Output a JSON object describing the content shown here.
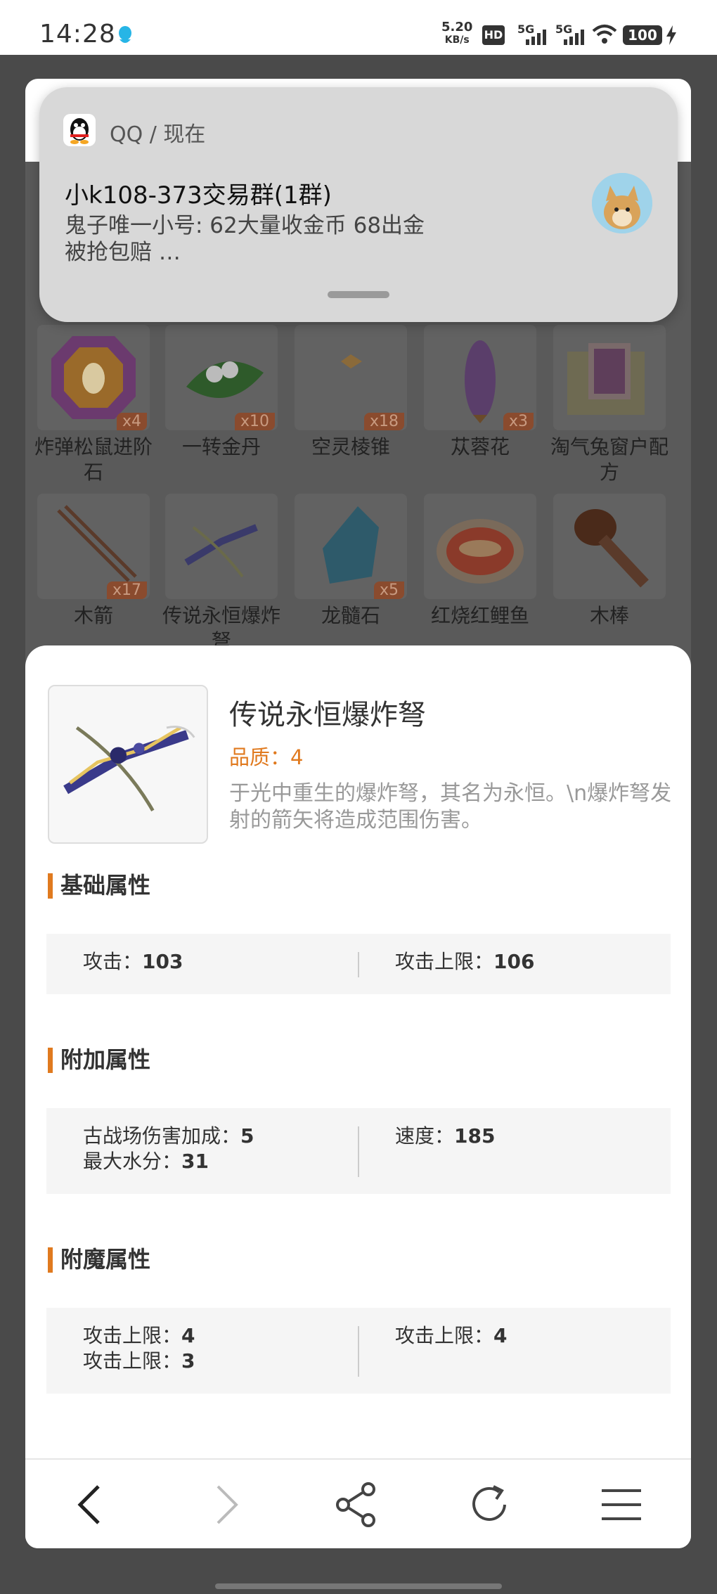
{
  "status_bar": {
    "time": "14:28",
    "speed_value": "5.20",
    "speed_unit": "KB/s",
    "hd_label": "HD",
    "network_1": "5G",
    "network_2": "5G",
    "battery": "100"
  },
  "notification": {
    "app_line": "QQ / 现在",
    "title": "小k108-373交易群(1群)",
    "body": "鬼子唯一小号: 62大量收金币  68出金\n 被抢包赔 …"
  },
  "grid_items": [
    {
      "name": "炸弹松鼠进阶石",
      "count": "x4",
      "icon": "gem-icon"
    },
    {
      "name": "一转金丹",
      "count": "x10",
      "icon": "pill-icon"
    },
    {
      "name": "空灵棱锥",
      "count": "x18",
      "icon": "pyramid-icon"
    },
    {
      "name": "苁蓉花",
      "count": "x3",
      "icon": "flower-icon"
    },
    {
      "name": "淘气兔窗户配方",
      "count": "",
      "icon": "scroll-icon"
    },
    {
      "name": "木箭",
      "count": "x17",
      "icon": "arrow-icon"
    },
    {
      "name": "传说永恒爆炸弩",
      "count": "",
      "icon": "crossbow-icon"
    },
    {
      "name": "龙髓石",
      "count": "x5",
      "icon": "crystal-icon"
    },
    {
      "name": "红烧红鲤鱼",
      "count": "",
      "icon": "fish-dish-icon"
    },
    {
      "name": "木棒",
      "count": "",
      "icon": "club-icon"
    }
  ],
  "detail": {
    "name": "传说永恒爆炸弩",
    "quality": "品质：4",
    "description": "于光中重生的爆炸弩，其名为永恒。\\n爆炸弩发射的箭矢将造成范围伤害。",
    "sections": [
      {
        "title": "基础属性",
        "left": [
          {
            "label": "攻击：",
            "value": "103"
          }
        ],
        "right": [
          {
            "label": "攻击上限：",
            "value": "106"
          }
        ]
      },
      {
        "title": "附加属性",
        "left": [
          {
            "label": "古战场伤害加成：",
            "value": "5"
          },
          {
            "label": "最大水分：",
            "value": "31"
          }
        ],
        "right": [
          {
            "label": "速度：",
            "value": "185"
          }
        ]
      },
      {
        "title": "附魔属性",
        "left": [
          {
            "label": "攻击上限：",
            "value": "4"
          },
          {
            "label": "攻击上限：",
            "value": "3"
          }
        ],
        "right": [
          {
            "label": "攻击上限：",
            "value": "4"
          }
        ]
      }
    ]
  },
  "nav": {
    "back_icon": "back-icon",
    "forward_icon": "forward-icon",
    "share_icon": "share-icon",
    "refresh_icon": "refresh-icon",
    "menu_icon": "menu-icon"
  },
  "colors": {
    "accent": "#e07a1f",
    "overlay": "#5a5a5a"
  }
}
